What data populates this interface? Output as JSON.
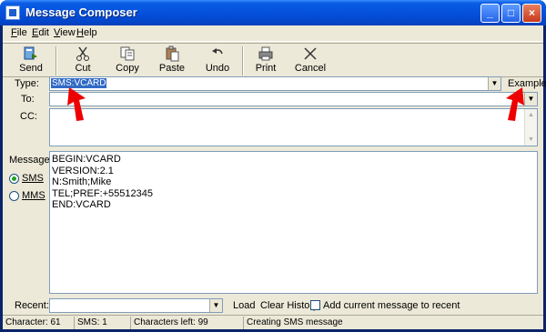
{
  "window": {
    "title": "Message Composer"
  },
  "menu": {
    "items": [
      {
        "underline": "F",
        "rest": "ile"
      },
      {
        "underline": "E",
        "rest": "dit"
      },
      {
        "underline": "V",
        "rest": "iew"
      },
      {
        "underline": "H",
        "rest": "elp"
      }
    ]
  },
  "toolbar": {
    "send": "Send",
    "cut": "Cut",
    "copy": "Copy",
    "paste": "Paste",
    "undo": "Undo",
    "print": "Print",
    "cancel": "Cancel"
  },
  "form": {
    "type_label": "Type:",
    "type_value": "SMS:VCARD",
    "example": "Example",
    "to_label": "To:",
    "to_value": "",
    "cc_label": "CC:",
    "cc_value": "",
    "message_label": "Message:",
    "sms_label": "SMS",
    "mms_label": "MMS",
    "format_selected": "SMS",
    "message_text": "BEGIN:VCARD\nVERSION:2.1\nN:Smith;Mike\nTEL;PREF:+55512345\nEND:VCARD"
  },
  "recent": {
    "label": "Recent:",
    "value": "",
    "load": "Load",
    "clear_history": "Clear History",
    "add_label": "Add current message to recent",
    "add_checked": false
  },
  "status": {
    "characters": "Character: 61",
    "sms": "SMS: 1",
    "chars_left": "Characters left: 99",
    "state": "Creating SMS message"
  },
  "colors": {
    "titlebar": "#0551dd",
    "selection": "#316ac5",
    "arrow": "#ee0000",
    "face": "#ece9d8"
  },
  "icons": [
    "send-icon",
    "scissors-icon",
    "copy-icon",
    "paste-icon",
    "undo-icon",
    "printer-icon",
    "close-x-icon"
  ]
}
